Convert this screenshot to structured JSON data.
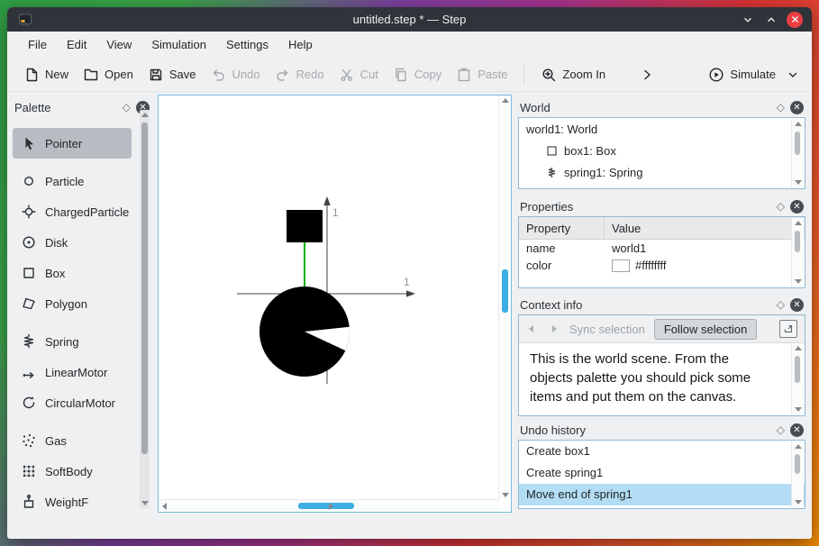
{
  "titlebar": {
    "title": "untitled.step * — Step"
  },
  "menubar": {
    "items": [
      "File",
      "Edit",
      "View",
      "Simulation",
      "Settings",
      "Help"
    ]
  },
  "toolbar": {
    "new": "New",
    "open": "Open",
    "save": "Save",
    "undo": "Undo",
    "redo": "Redo",
    "cut": "Cut",
    "copy": "Copy",
    "paste": "Paste",
    "zoom_in": "Zoom In",
    "simulate": "Simulate"
  },
  "palette": {
    "title": "Palette",
    "items": [
      {
        "label": "Pointer",
        "icon": "pointer-icon",
        "selected": true
      },
      {
        "label": "Particle",
        "icon": "particle-icon"
      },
      {
        "label": "ChargedParticle",
        "icon": "charged-particle-icon"
      },
      {
        "label": "Disk",
        "icon": "disk-icon"
      },
      {
        "label": "Box",
        "icon": "box-icon"
      },
      {
        "label": "Polygon",
        "icon": "polygon-icon"
      },
      {
        "label": "Spring",
        "icon": "spring-icon"
      },
      {
        "label": "LinearMotor",
        "icon": "linear-motor-icon"
      },
      {
        "label": "CircularMotor",
        "icon": "circular-motor-icon"
      },
      {
        "label": "Gas",
        "icon": "gas-icon"
      },
      {
        "label": "SoftBody",
        "icon": "soft-body-icon"
      },
      {
        "label": "WeightF",
        "icon": "weight-force-icon"
      }
    ]
  },
  "canvas": {
    "x_axis_label": "1",
    "y_axis_label": "1",
    "colors": {
      "spring_line": "#00b400",
      "bodies": "#000000",
      "scrollbar_thumb": "#3daee2"
    }
  },
  "world": {
    "title": "World",
    "items": [
      {
        "label": "world1: World"
      },
      {
        "label": "box1: Box",
        "icon": "box-icon"
      },
      {
        "label": "spring1: Spring",
        "icon": "spring-icon"
      }
    ]
  },
  "properties": {
    "title": "Properties",
    "columns": {
      "property": "Property",
      "value": "Value"
    },
    "rows": [
      {
        "property": "name",
        "value": "world1"
      },
      {
        "property": "color",
        "value": "#ffffffff",
        "swatch": "#ffffff"
      }
    ]
  },
  "context": {
    "title": "Context info",
    "sync": "Sync selection",
    "follow": "Follow selection",
    "text": "This is the world scene. From the objects palette you should pick some items and put them on the canvas."
  },
  "undo_history": {
    "title": "Undo history",
    "items": [
      {
        "label": "Create box1",
        "selected": false
      },
      {
        "label": "Create spring1",
        "selected": false
      },
      {
        "label": "Move end of spring1",
        "selected": true
      }
    ]
  },
  "colors": {
    "accent": "#3daee2",
    "titlebar": "#2f343a",
    "close_button": "#e93e41",
    "selection_row": "#b3ddf4"
  }
}
